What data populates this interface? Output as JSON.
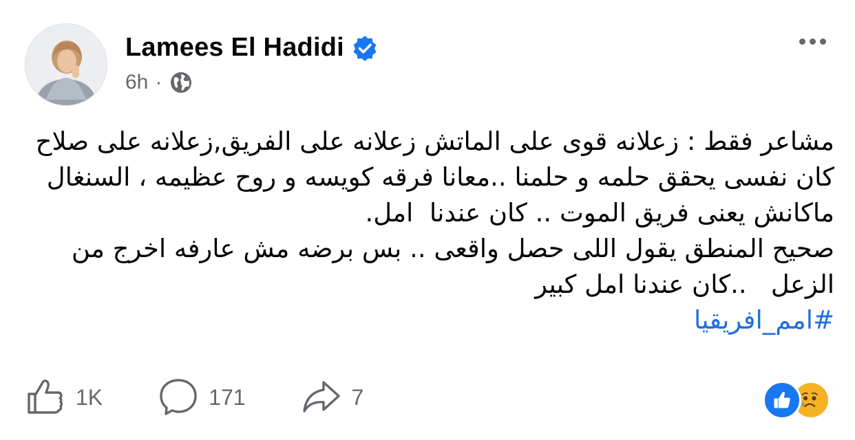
{
  "author": {
    "name": "Lamees El Hadidi",
    "verified": true,
    "avatar_icon": "profile-photo",
    "verified_icon": "verified-badge-icon"
  },
  "meta": {
    "time": "6h",
    "separator": "·",
    "privacy_icon": "globe-icon"
  },
  "menu": {
    "more_icon": "more-options-icon"
  },
  "post": {
    "text": "مشاعر فقط : زعلانه قوى على الماتش زعلانه على الفريق,زعلانه على صلاح  كان نفسى يحقق حلمه و حلمنا ..معانا فرقه كويسه و روح عظيمه ، السنغال ماكانش يعنى فريق الموت .. كان عندنا  امل.\nصحيح المنطق يقول اللى حصل واقعى .. بس برضه مش عارفه اخرج من الزعل   ..كان عندنا امل كبير",
    "hashtag": "#امم_افريقيا"
  },
  "actions": {
    "like_count": "1K",
    "comment_count": "171",
    "share_count": "7"
  },
  "reactions": [
    "like",
    "sad"
  ],
  "colors": {
    "accent": "#1877f2",
    "hashtag": "#216fdb",
    "secondary_text": "#65676b",
    "sad": "#f7b125"
  }
}
